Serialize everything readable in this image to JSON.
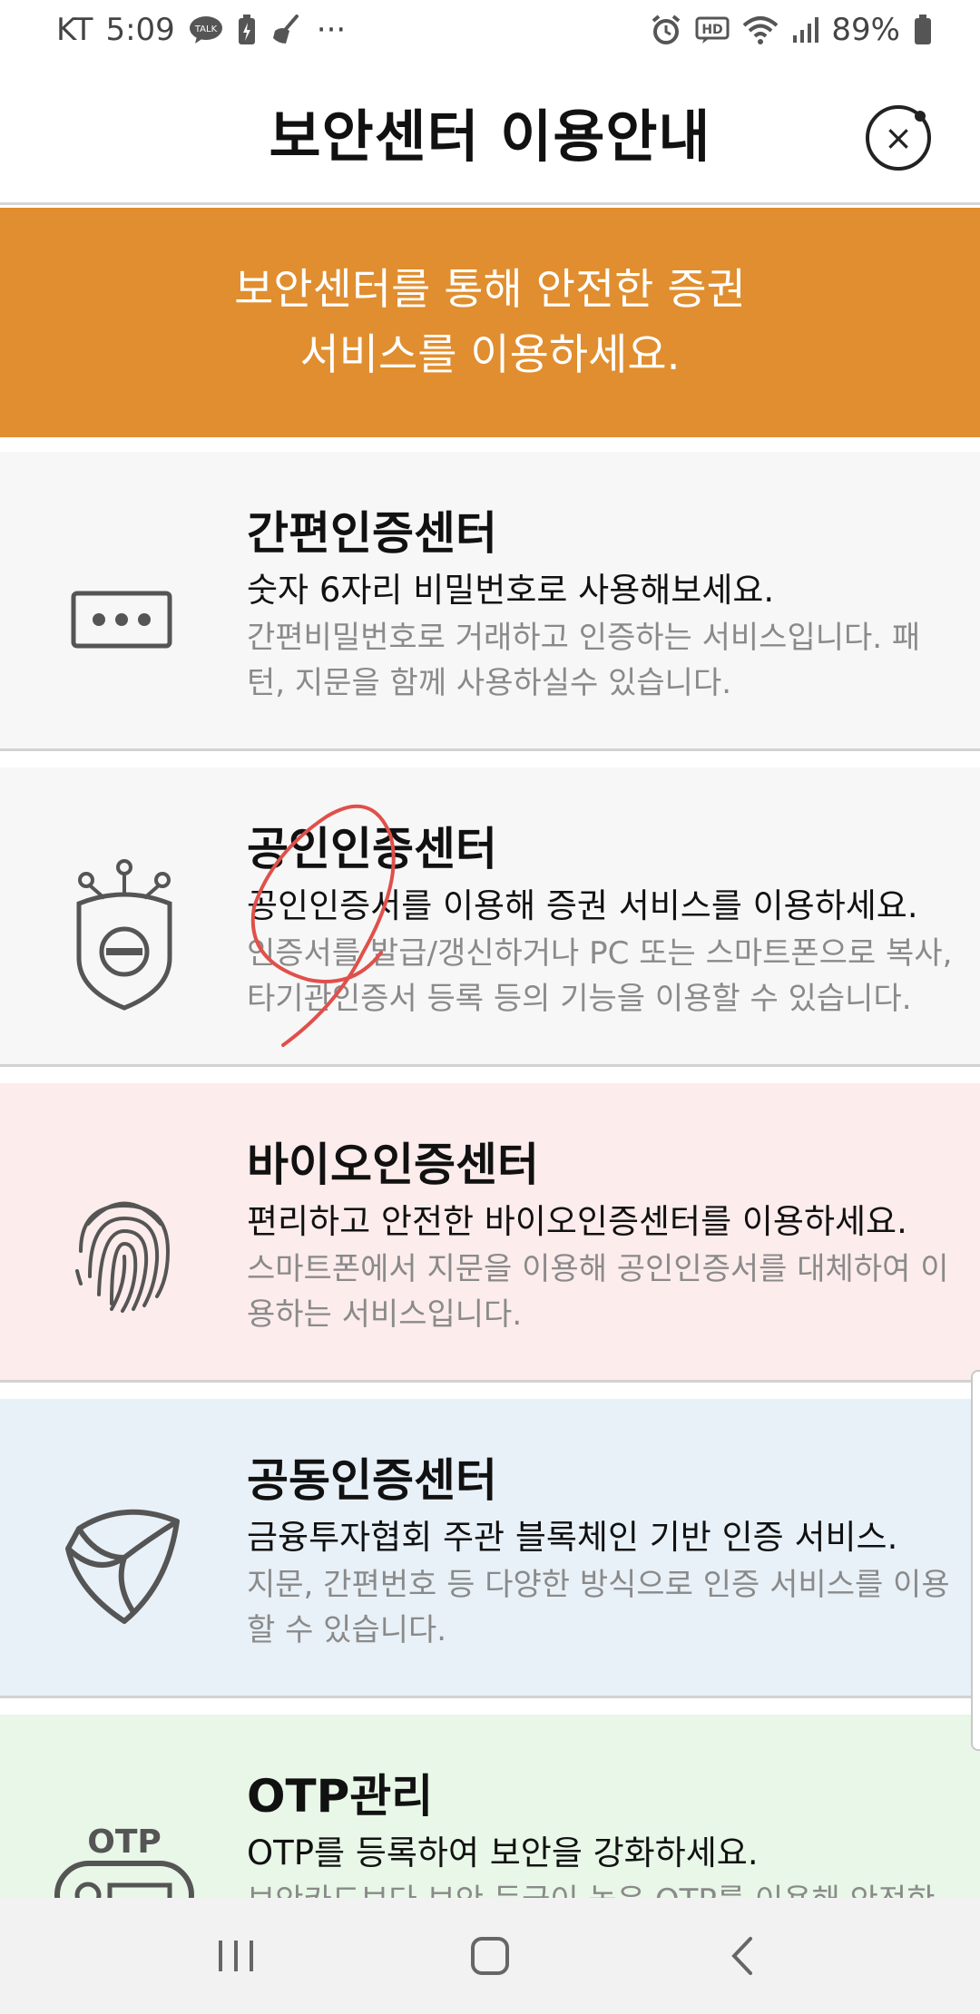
{
  "status_bar": {
    "carrier": "KT",
    "time": "5:09",
    "battery_percent": "89%",
    "left_icons": [
      "talk-icon",
      "battery-saver-icon",
      "cleaner-icon",
      "more-dots-icon"
    ],
    "right_icons": [
      "alarm-icon",
      "hd-icon",
      "wifi-icon",
      "signal-icon",
      "battery-icon"
    ],
    "talk_label": "TALK",
    "hd_label": "HD",
    "more_label": "···"
  },
  "header": {
    "title": "보안센터 이용안내",
    "close_glyph": "×"
  },
  "banner": {
    "line1": "보안센터를 통해 안전한 증권",
    "line2": "서비스를 이용하세요.",
    "background": "#e08e2f"
  },
  "cards": [
    {
      "title": "간편인증센터",
      "subtitle": "숫자 6자리 비밀번호로 사용해보세요.",
      "description": "간편비밀번호로 거래하고 인증하는 서비스입니다. 패턴, 지문을 함께 사용하실수 있습니다.",
      "icon": "password-dots-icon",
      "background": "#f7f7f7"
    },
    {
      "title": "공인인증센터",
      "subtitle": "공인인증서를 이용해 증권 서비스를 이용하세요.",
      "description": "인증서를 발급/갱신하거나 PC 또는 스마트폰으로 복사, 타기관인증서 등록 등의 기능을 이용할 수 있습니다.",
      "icon": "certificate-shield-icon",
      "background": "#f7f7f7"
    },
    {
      "title": "바이오인증센터",
      "subtitle": "편리하고 안전한 바이오인증센터를 이용하세요.",
      "description": "스마트폰에서 지문을 이용해 공인인증서를 대체하여 이용하는 서비스입니다.",
      "icon": "fingerprint-icon",
      "background": "#fdecec"
    },
    {
      "title": "공동인증센터",
      "subtitle": "금융투자협회 주관 블록체인 기반 인증 서비스.",
      "description": "지문, 간편번호 등 다양한 방식으로 인증 서비스를 이용할 수 있습니다.",
      "icon": "shield-swirl-icon",
      "background": "#e9f1f8"
    },
    {
      "title": "OTP관리",
      "subtitle": "OTP를 등록하여 보안을 강화하세요.",
      "description": "보안카드보다 보안 등급이 높은 OTP를 이용해 안전한",
      "icon": "otp-device-icon",
      "icon_label": "OTP",
      "background": "#e8f7e7"
    }
  ],
  "nav_bar": {
    "buttons": [
      "recent-apps-icon",
      "home-icon",
      "back-icon"
    ]
  }
}
